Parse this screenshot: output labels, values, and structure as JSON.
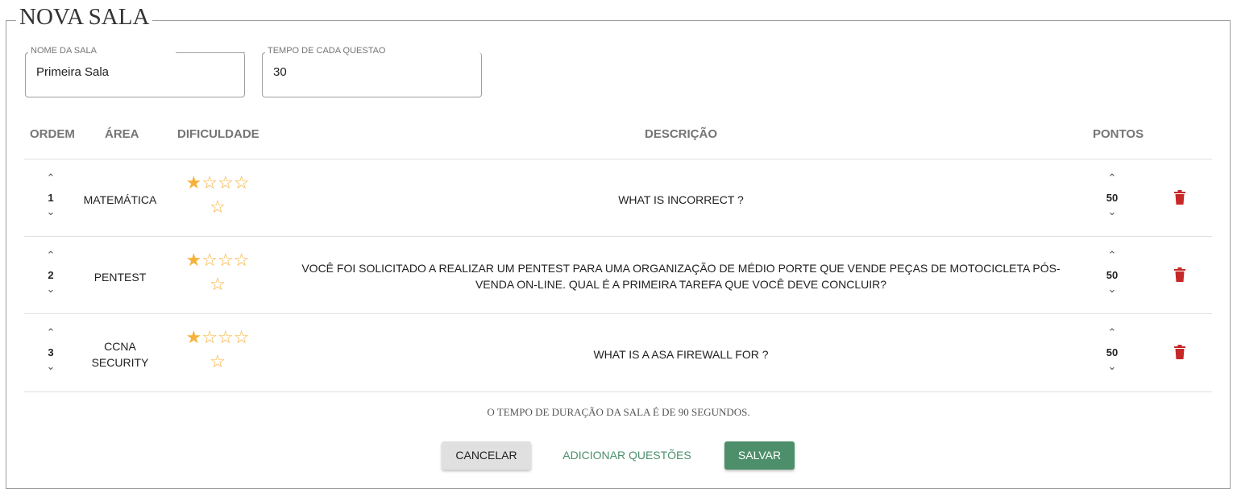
{
  "form": {
    "title": "NOVA SALA",
    "room_name_label": "NOME DA SALA",
    "room_name_value": "Primeira Sala",
    "time_label": "TEMPO DE CADA QUESTAO",
    "time_value": "30"
  },
  "table": {
    "headers": {
      "order": "ORDEM",
      "area": "ÁREA",
      "difficulty": "DIFICULDADE",
      "description": "DESCRIÇÃO",
      "points": "PONTOS"
    },
    "rows": [
      {
        "order": "1",
        "area": "MATEMÁTICA",
        "difficulty_rating": 1,
        "difficulty_max": 5,
        "description": "WHAT IS INCORRECT ?",
        "points": "50"
      },
      {
        "order": "2",
        "area": "PENTEST",
        "difficulty_rating": 1,
        "difficulty_max": 5,
        "description": "VOCÊ FOI SOLICITADO A REALIZAR UM PENTEST PARA UMA ORGANIZAÇÃO DE MÉDIO PORTE QUE VENDE PEÇAS DE MOTOCICLETA PÓS-VENDA ON-LINE. QUAL É A PRIMEIRA TAREFA QUE VOCÊ DEVE CONCLUIR?",
        "points": "50"
      },
      {
        "order": "3",
        "area": "CCNA SECURITY",
        "difficulty_rating": 1,
        "difficulty_max": 5,
        "description": "WHAT IS A ASA FIREWALL FOR ?",
        "points": "50"
      }
    ]
  },
  "footer": {
    "duration_note": "O TEMPO DE DURAÇÃO DA SALA É DE 90 SEGUNDOS.",
    "cancel_label": "CANCELAR",
    "add_label": "ADICIONAR QUESTÕES",
    "save_label": "SALVAR"
  },
  "colors": {
    "star": "#f5b23b",
    "trash": "#c62828",
    "primary_green": "#4e8f6b"
  },
  "icons": {
    "up": "chevron-up-icon",
    "down": "chevron-down-icon",
    "star_filled": "star-filled-icon",
    "star_empty": "star-outline-icon",
    "delete": "trash-icon"
  }
}
